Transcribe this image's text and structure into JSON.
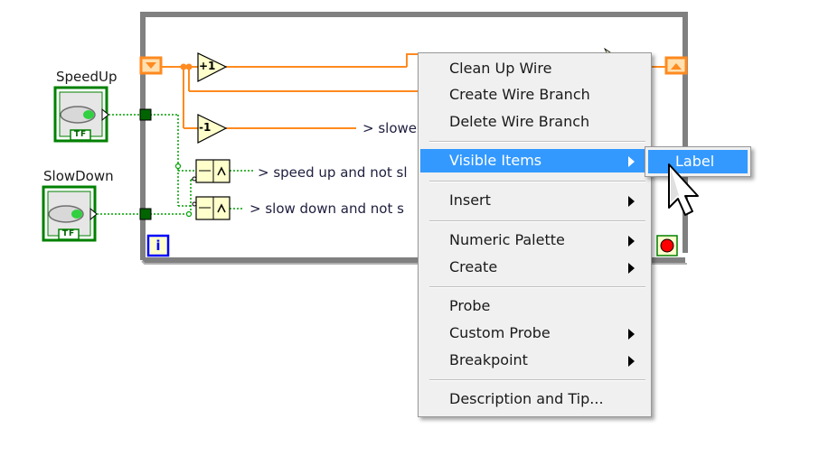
{
  "diagram": {
    "controls": [
      {
        "label": "SpeedUp",
        "terminal_text": "TF"
      },
      {
        "label": "SlowDown",
        "terminal_text": "TF"
      }
    ],
    "increment_label": "+1",
    "decrement_label": "-1",
    "wire_labels": [
      "> slowe",
      "> speed up and not sl",
      "> slow down and not s"
    ],
    "iteration_terminal": "i",
    "colors": {
      "loop_border": "#808080",
      "numeric_wire": "#ff8a1f",
      "boolean_wire": "#00a000",
      "boolean_terminal": "#006400",
      "node_fill": "#ffffcc",
      "iteration_border": "#0000ff",
      "stop_red": "#ff0000",
      "menu_highlight": "#3399ff"
    }
  },
  "context_menu": {
    "items": [
      {
        "label": "Clean Up Wire",
        "submenu": false
      },
      {
        "label": "Create Wire Branch",
        "submenu": false
      },
      {
        "label": "Delete Wire Branch",
        "submenu": false
      },
      {
        "label": "Visible Items",
        "submenu": true,
        "highlighted": true
      },
      {
        "label": "Insert",
        "submenu": true
      },
      {
        "label": "Numeric Palette",
        "submenu": true
      },
      {
        "label": "Create",
        "submenu": true
      },
      {
        "label": "Probe",
        "submenu": false
      },
      {
        "label": "Custom Probe",
        "submenu": true
      },
      {
        "label": "Breakpoint",
        "submenu": true
      },
      {
        "label": "Description and Tip...",
        "submenu": false
      }
    ]
  },
  "submenu": {
    "items": [
      {
        "label": "Label",
        "highlighted": true
      }
    ]
  }
}
